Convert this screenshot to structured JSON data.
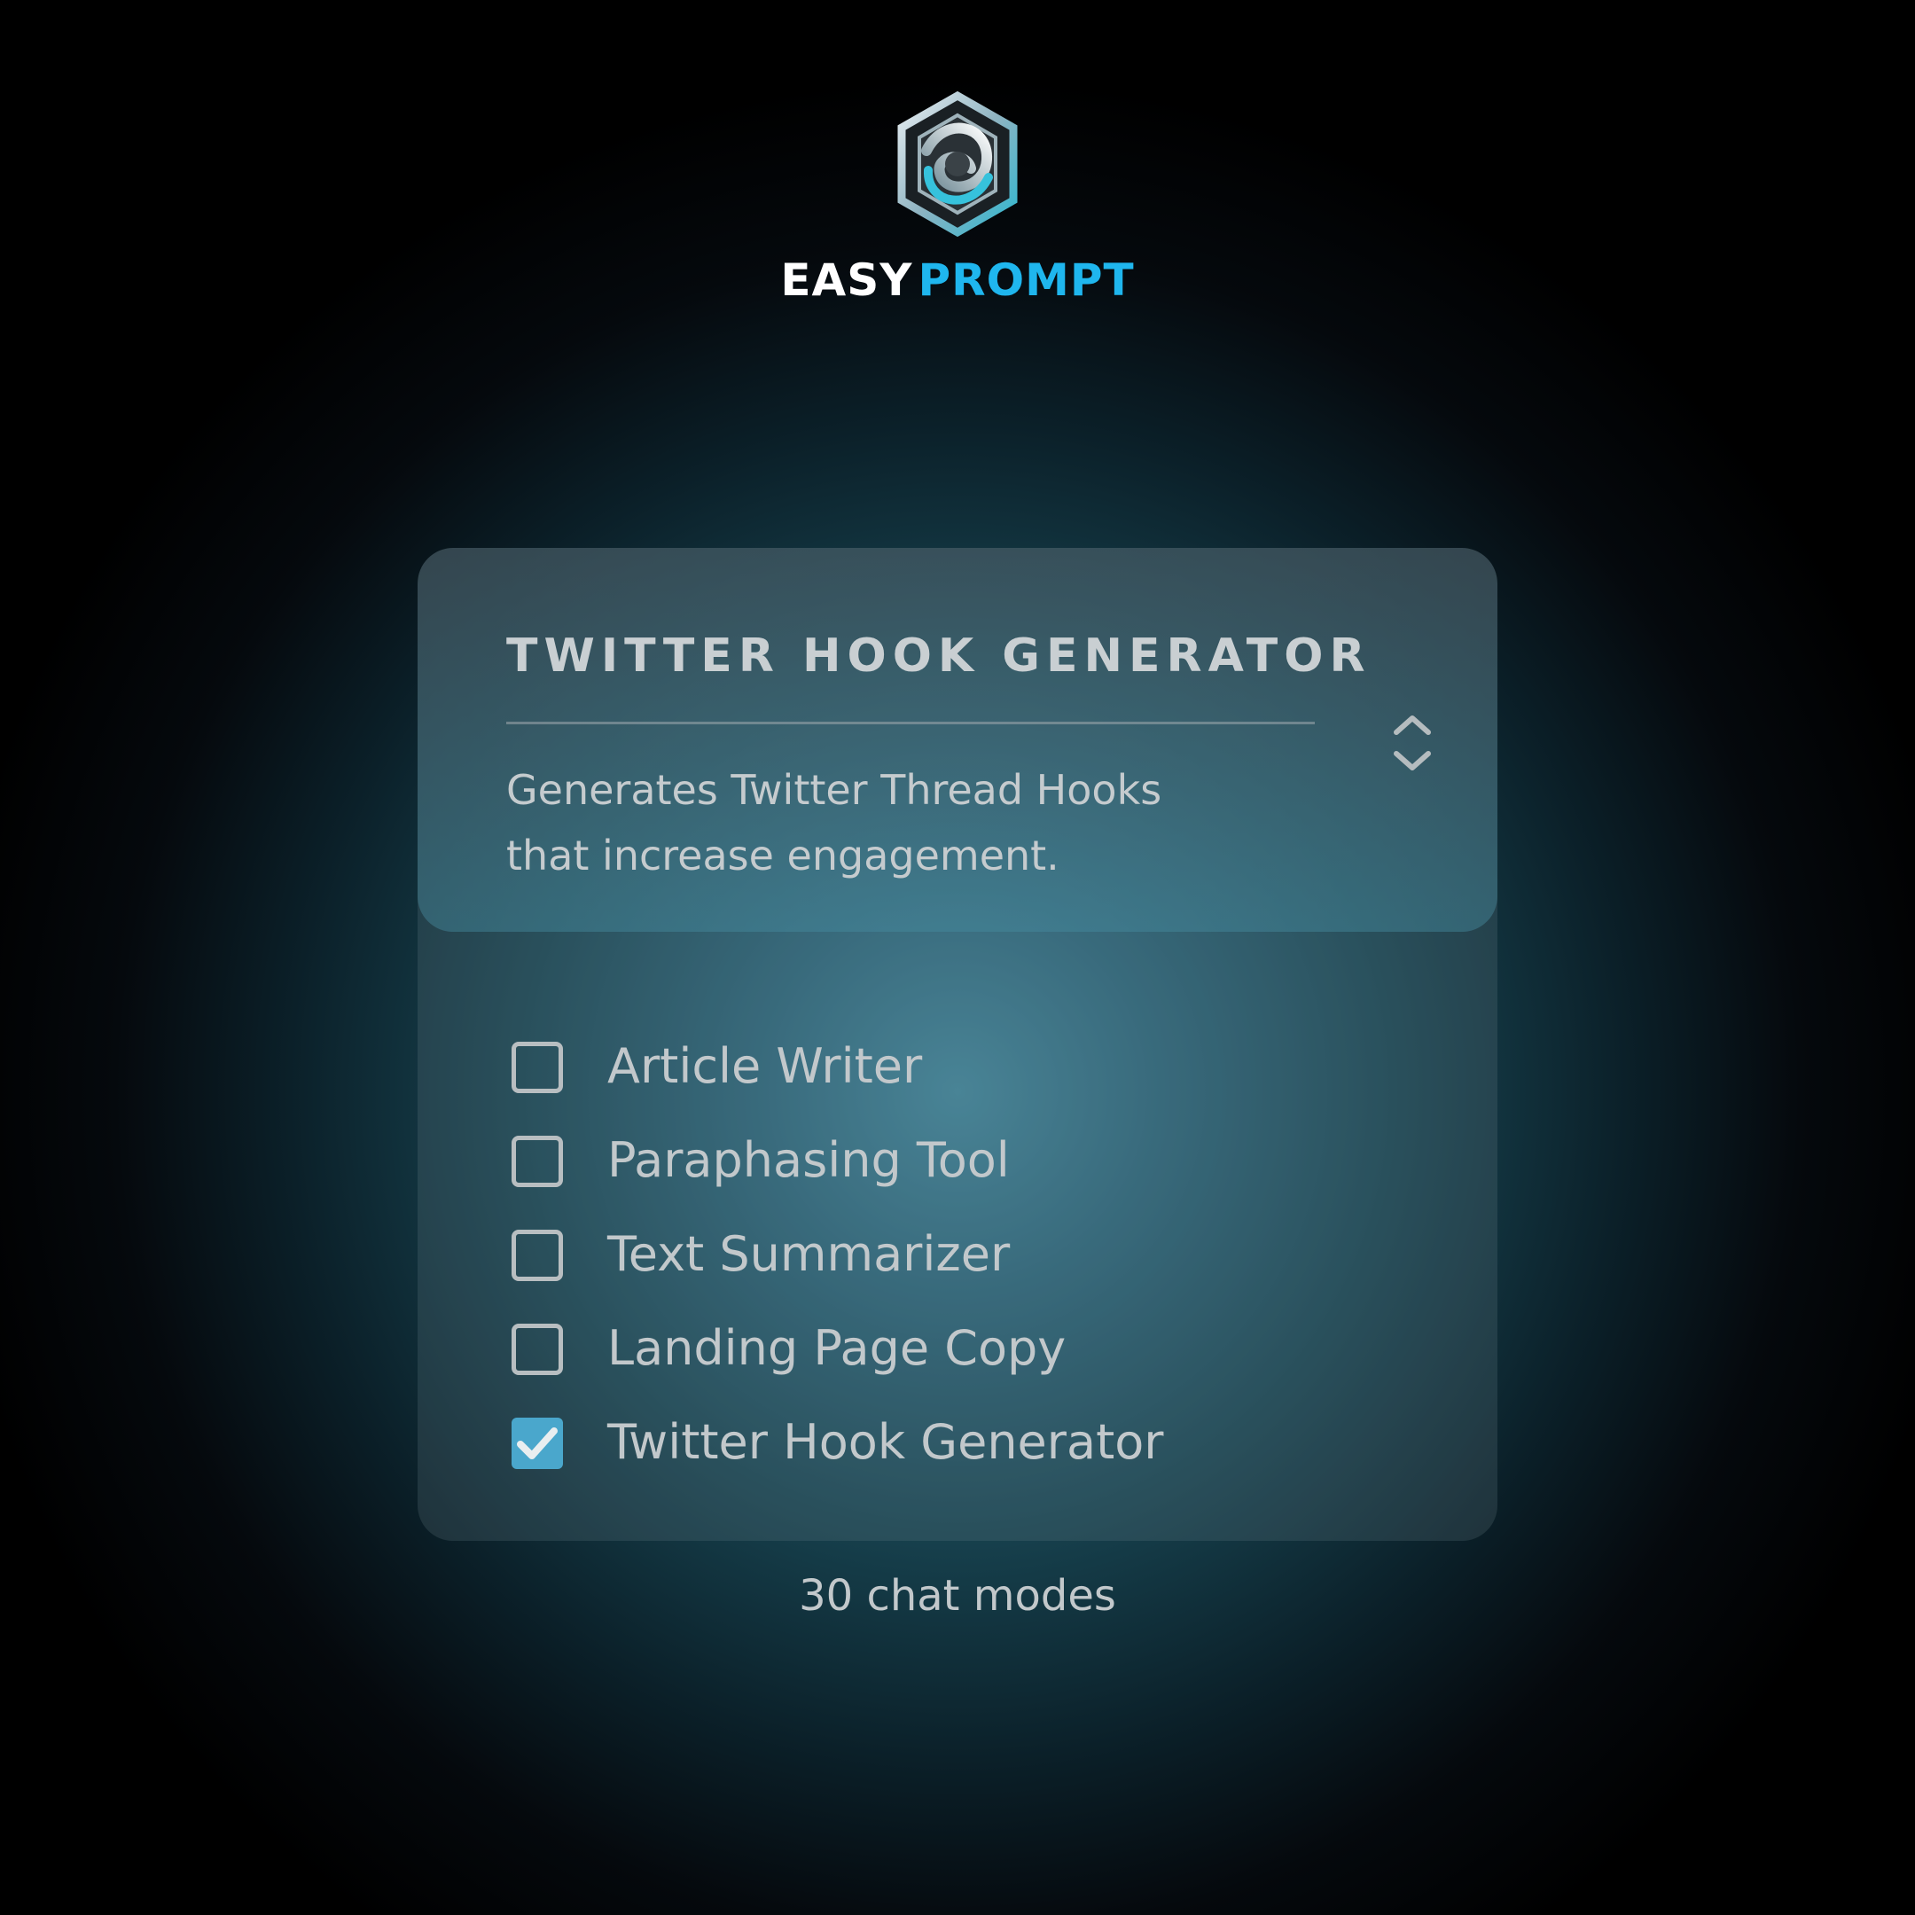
{
  "brand": {
    "word_1": "EASY",
    "word_2": "PROMPT",
    "logo_icon": "hexagon-knot-logo",
    "accent_color": "#1fb6ee"
  },
  "mode_card": {
    "title": "TWITTER HOOK GENERATOR",
    "description": "Generates Twitter Thread Hooks that increase engagement.",
    "stepper_icon": "chevron-up-down-icon"
  },
  "options": [
    {
      "label": "Article Writer",
      "checked": false
    },
    {
      "label": "Paraphasing Tool",
      "checked": false
    },
    {
      "label": "Text Summarizer",
      "checked": false
    },
    {
      "label": "Landing Page Copy",
      "checked": false
    },
    {
      "label": "Twitter Hook Generator",
      "checked": true
    }
  ],
  "checkbox_checked_color": "#4aa7cc",
  "footer": {
    "text": "30 chat modes"
  }
}
